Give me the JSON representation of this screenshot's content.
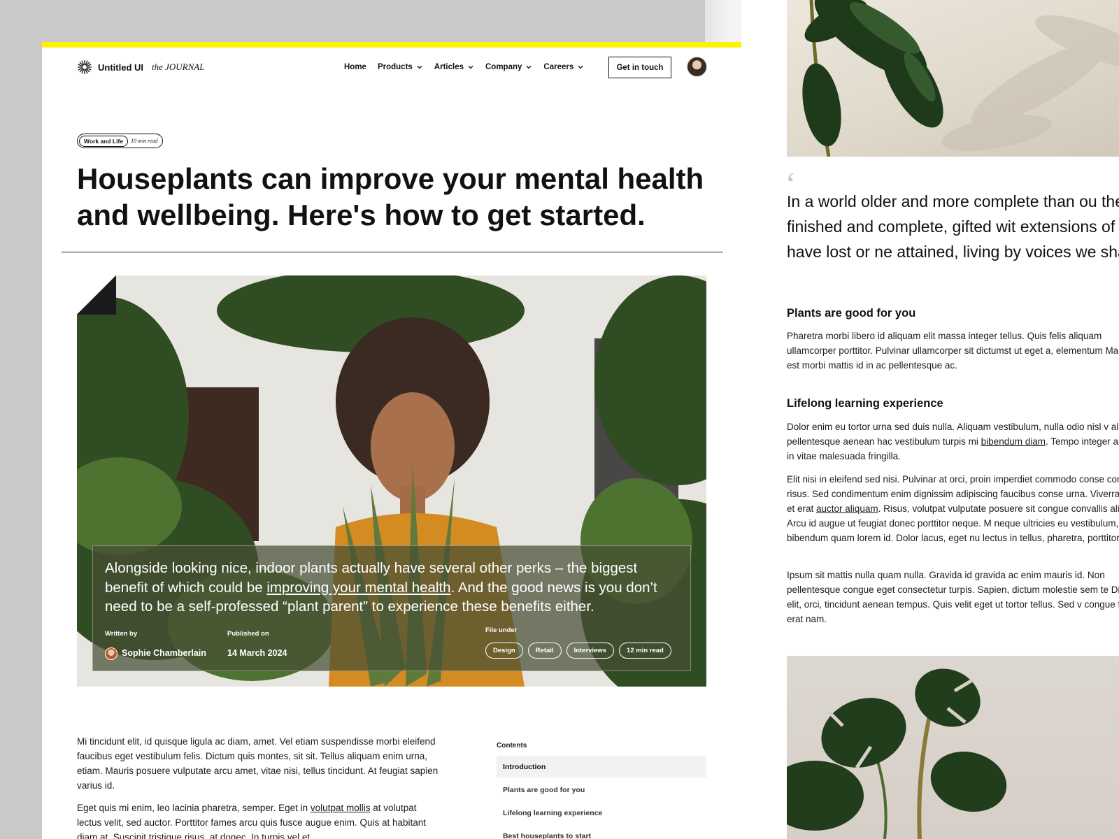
{
  "header": {
    "brand": "Untitled UI",
    "journal": "the JOURNAL",
    "nav": [
      {
        "label": "Home"
      },
      {
        "label": "Products"
      },
      {
        "label": "Articles"
      },
      {
        "label": "Company"
      },
      {
        "label": "Careers"
      }
    ],
    "cta_label": "Get in touch"
  },
  "article": {
    "category": "Work and Life",
    "read_time": "10 min read",
    "title": "Houseplants can improve your mental health and wellbeing. Here's how to get started.",
    "caption": {
      "before_link": "Alongside looking nice, indoor plants actually have several other perks – the biggest benefit of which could be ",
      "link": "improving your mental health",
      "after_link": ". And the good news is you don’t need to be a self-professed “plant parent” to experience these benefits either.",
      "written_by_label": "Written by",
      "author": "Sophie Chamberlain",
      "published_label": "Published on",
      "published": "14 March 2024",
      "file_under_label": "File under",
      "tags": [
        "Design",
        "Retail",
        "Interviews",
        "12 min read"
      ]
    },
    "body": {
      "p1": "Mi tincidunt elit, id quisque ligula ac diam, amet. Vel etiam suspendisse morbi eleifend faucibus eget vestibulum felis. Dictum quis montes, sit sit. Tellus aliquam enim urna, etiam. Mauris posuere vulputate arcu amet, vitae nisi, tellus tincidunt. At feugiat sapien varius id.",
      "p2_before": "Eget quis mi enim, leo lacinia pharetra, semper. Eget in ",
      "p2_link": "volutpat mollis",
      "p2_after": " at volutpat lectus velit, sed auctor. Porttitor fames arcu quis fusce augue enim. Quis at habitant diam at. Suscipit tristique risus, at donec. In turpis vel et"
    },
    "contents": {
      "label": "Contents",
      "items": [
        {
          "label": "Introduction"
        },
        {
          "label": "Plants are good for you"
        },
        {
          "label": "Lifelong learning experience"
        },
        {
          "label": "Best houseplants to start"
        }
      ]
    }
  },
  "right_panel": {
    "quote": "In a world older and more complete than ou they move finished and complete, gifted wit extensions of the senses we have lost or ne attained, living by voices we shall never hea",
    "section1": {
      "heading": "Plants are good for you",
      "p": "Pharetra morbi libero id aliquam elit massa integer tellus. Quis felis aliquam ullamcorper porttitor. Pulvinar ullamcorper sit dictumst ut eget a, elementum Maecenas est morbi mattis id in ac pellentesque ac."
    },
    "section2": {
      "heading": "Lifelong learning experience",
      "p1_before": "Dolor enim eu tortor urna sed duis nulla. Aliquam vestibulum, nulla odio nisl v aliquet pellentesque aenean hac vestibulum turpis mi ",
      "p1_link": "bibendum diam",
      "p1_after": ". Tempo integer aliquam in vitae malesuada fringilla.",
      "p2_before": "Elit nisi in eleifend sed nisi. Pulvinar at orci, proin imperdiet commodo conse convallis risus. Sed condimentum enim dignissim adipiscing faucibus conse urna. Viverra purus et erat ",
      "p2_link": "auctor aliquam",
      "p2_after": ". Risus, volutpat vulputate posuere sit congue convallis aliquet. Arcu id augue ut feugiat donec porttitor neque. M neque ultricies eu vestibulum, bibendum quam lorem id. Dolor lacus, eget nu lectus in tellus, pharetra, porttitor.",
      "p3": "Ipsum sit mattis nulla quam nulla. Gravida id gravida ac enim mauris id. Non pellentesque congue eget consectetur turpis. Sapien, dictum molestie sem te Diam elit, orci, tincidunt aenean tempus. Quis velit eget ut tortor tellus. Sed v congue felis elit erat nam."
    }
  },
  "colors": {
    "accent_bar": "#fff200",
    "text": "#111111"
  },
  "icons": {
    "logo": "sunburst-icon",
    "nav_dropdown": "chevron-down-icon",
    "quote": "quote-mark-icon"
  }
}
